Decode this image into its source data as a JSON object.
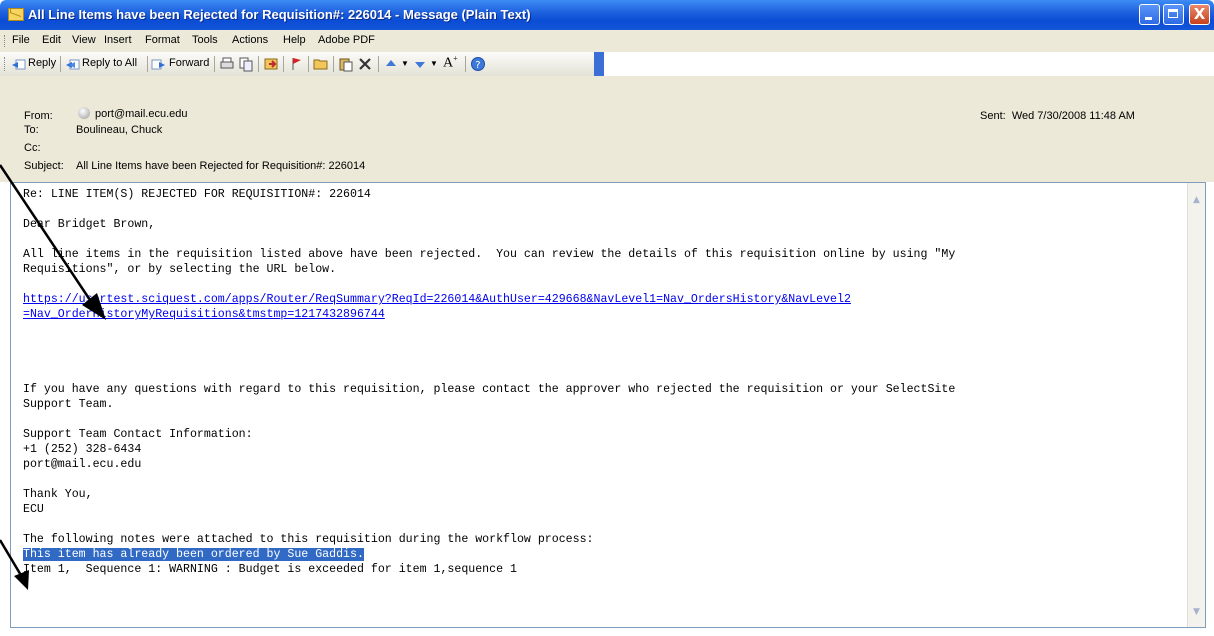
{
  "window": {
    "title": "All Line Items have been Rejected for Requisition#: 226014 - Message (Plain Text)",
    "close_glyph": "X"
  },
  "menu": [
    "File",
    "Edit",
    "View",
    "Insert",
    "Format",
    "Tools",
    "Actions",
    "Help",
    "Adobe PDF"
  ],
  "toolbar": {
    "reply": "Reply",
    "reply_all": "Reply to All",
    "forward": "Forward"
  },
  "header": {
    "from_label": "From:",
    "from_value": "port@mail.ecu.edu",
    "to_label": "To:",
    "to_value": "Boulineau, Chuck",
    "cc_label": "Cc:",
    "subject_label": "Subject:",
    "subject_value": "All Line Items have been Rejected for Requisition#: 226014",
    "sent_label": "Sent:",
    "sent_value": "Wed 7/30/2008 11:48 AM"
  },
  "body": {
    "line1": "Re: LINE ITEM(S) REJECTED FOR REQUISITION#: 226014",
    "greeting": "Dear Bridget Brown,",
    "para1a": "All line items in the requisition listed above have been rejected.  You can review the details of this requisition online by using \"My",
    "para1b": "Requisitions\", or by selecting the URL below.",
    "url_line1": "https://usertest.sciquest.com/apps/Router/ReqSummary?ReqId=226014&AuthUser=429668&NavLevel1=Nav_OrdersHistory&NavLevel2",
    "url_line2": "=Nav_OrderHistoryMyRequisitions&tmstmp=1217432896744",
    "para2a": "If you have any questions with regard to this requisition, please contact the approver who rejected the requisition or your SelectSite",
    "para2b": "Support Team.",
    "support_heading": "Support Team Contact Information:",
    "support_phone": "+1 (252) 328-6434",
    "support_email": "port@mail.ecu.edu",
    "thanks": "Thank You,",
    "signature": "ECU",
    "notes_intro": "The following notes were attached to this requisition during the workflow process:",
    "note1": "This item has already been ordered by Sue Gaddis.",
    "note2": "Item 1,  Sequence 1: WARNING : Budget is exceeded for item 1,sequence 1"
  },
  "colors": {
    "title_blue": "#0a4cd4",
    "chrome": "#ece9d8",
    "link": "#0000ee",
    "selection": "#316ac5"
  }
}
